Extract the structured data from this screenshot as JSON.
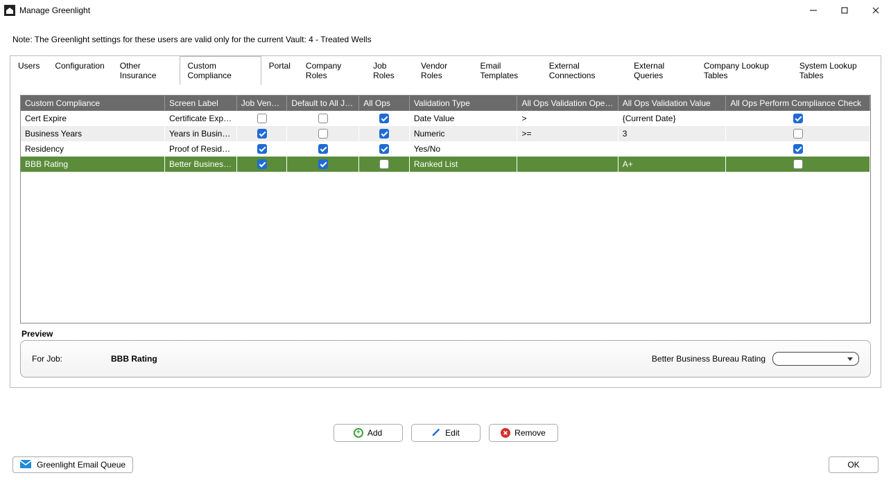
{
  "window": {
    "title": "Manage Greenlight"
  },
  "note": "Note:  The Greenlight settings for these users are valid only for the current Vault: 4 - Treated Wells",
  "tabs": [
    {
      "id": "users",
      "label": "Users"
    },
    {
      "id": "configuration",
      "label": "Configuration"
    },
    {
      "id": "other-insurance",
      "label": "Other Insurance"
    },
    {
      "id": "custom-compliance",
      "label": "Custom Compliance"
    },
    {
      "id": "portal",
      "label": "Portal"
    },
    {
      "id": "company-roles",
      "label": "Company Roles"
    },
    {
      "id": "job-roles",
      "label": "Job Roles"
    },
    {
      "id": "vendor-roles",
      "label": "Vendor Roles"
    },
    {
      "id": "email-templates",
      "label": "Email Templates"
    },
    {
      "id": "external-connections",
      "label": "External Connections"
    },
    {
      "id": "external-queries",
      "label": "External Queries"
    },
    {
      "id": "company-lookup-tables",
      "label": "Company Lookup Tables"
    },
    {
      "id": "system-lookup-tables",
      "label": "System Lookup Tables"
    }
  ],
  "active_tab": "custom-compliance",
  "grid": {
    "columns": [
      "Custom Compliance",
      "Screen Label",
      "Job Vendors",
      "Default to All Jobs",
      "All Ops",
      "Validation Type",
      "All Ops Validation Operator",
      "All Ops Validation Value",
      "All Ops Perform Compliance Check"
    ],
    "rows": [
      {
        "custom_compliance": "Cert Expire",
        "screen_label": "Certificate Expirati...",
        "job_vendors": false,
        "default_all_jobs": false,
        "all_ops": true,
        "validation_type": "Date Value",
        "all_ops_operator": ">",
        "all_ops_value": "{Current Date}",
        "all_ops_check": true,
        "selected": false
      },
      {
        "custom_compliance": "Business Years",
        "screen_label": "Years in Business",
        "job_vendors": true,
        "default_all_jobs": false,
        "all_ops": true,
        "validation_type": "Numeric",
        "all_ops_operator": ">=",
        "all_ops_value": "3",
        "all_ops_check": false,
        "selected": false
      },
      {
        "custom_compliance": "Residency",
        "screen_label": "Proof of Residency",
        "job_vendors": true,
        "default_all_jobs": true,
        "all_ops": true,
        "validation_type": "Yes/No",
        "all_ops_operator": "",
        "all_ops_value": "",
        "all_ops_check": true,
        "selected": false
      },
      {
        "custom_compliance": "BBB Rating",
        "screen_label": "Better Business B...",
        "job_vendors": true,
        "default_all_jobs": true,
        "all_ops": false,
        "validation_type": "Ranked List",
        "all_ops_operator": "",
        "all_ops_value": "A+",
        "all_ops_check": false,
        "selected": true
      }
    ]
  },
  "preview": {
    "header": "Preview",
    "forjob_label": "For Job:",
    "name": "BBB Rating",
    "field_label": "Better Business Bureau Rating",
    "field_value": ""
  },
  "buttons": {
    "add": "Add",
    "edit": "Edit",
    "remove": "Remove",
    "ok": "OK",
    "email_queue": "Greenlight Email Queue"
  }
}
